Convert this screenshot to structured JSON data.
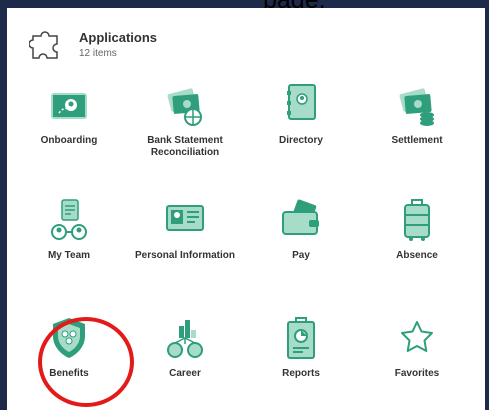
{
  "header": {
    "title": "Applications",
    "count": "12 items"
  },
  "partial_text": "page,",
  "apps": [
    {
      "id": "onboarding",
      "label": "Onboarding",
      "icon": "onboarding-icon"
    },
    {
      "id": "bank",
      "label": "Bank Statement Reconciliation",
      "icon": "bank-statement-icon"
    },
    {
      "id": "directory",
      "label": "Directory",
      "icon": "directory-icon"
    },
    {
      "id": "settlement",
      "label": "Settlement",
      "icon": "settlement-icon"
    },
    {
      "id": "myteam",
      "label": "My Team",
      "icon": "my-team-icon"
    },
    {
      "id": "personal",
      "label": "Personal Information",
      "icon": "personal-information-icon"
    },
    {
      "id": "pay",
      "label": "Pay",
      "icon": "pay-icon"
    },
    {
      "id": "absence",
      "label": "Absence",
      "icon": "absence-icon"
    },
    {
      "id": "benefits",
      "label": "Benefits",
      "icon": "benefits-icon"
    },
    {
      "id": "career",
      "label": "Career",
      "icon": "career-icon"
    },
    {
      "id": "reports",
      "label": "Reports",
      "icon": "reports-icon"
    },
    {
      "id": "favorites",
      "label": "Favorites",
      "icon": "favorites-icon"
    }
  ],
  "colors": {
    "accent": "#2e9e7c",
    "accent_light": "#a6dcc8",
    "frame": "#1e2a4a",
    "highlight": "#e31a1a"
  }
}
